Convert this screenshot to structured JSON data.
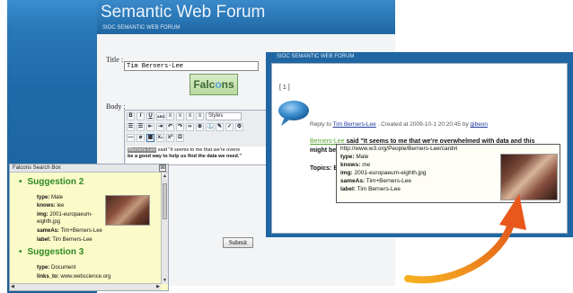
{
  "forum": {
    "title": "Semantic Web Forum",
    "subtitle": "SIOC SEMANTIC WEB FORUM",
    "title_label": "Title :",
    "title_value": "Tim Berners-Lee",
    "body_label": "Body :",
    "logo_text_a": "Falc",
    "logo_text_b": "o",
    "logo_text_c": "ns",
    "styles_value": "Styles",
    "editor_tag": "Berners-Lee",
    "editor_text": " said \"It seems to me that we're overw",
    "editor_text2": "be a good way to help us find the data we need.\"",
    "submit_label": "Submit"
  },
  "toolbar": {
    "row1": [
      "B",
      "I",
      "U",
      "ABC",
      "≡",
      "≡",
      "≡",
      "≡"
    ],
    "row2": [
      "☰",
      "☰",
      "⇤",
      "⇥",
      "↶",
      "↷",
      "∞",
      "⊕",
      "⚓",
      "✎",
      "✓",
      "⚙"
    ],
    "row3": [
      "—",
      "⌀",
      "▦",
      "x₁",
      "x²",
      "Ω"
    ]
  },
  "search_box": {
    "title": "Falcons Search Box",
    "close": "⊠",
    "suggestion2": {
      "heading": "Suggestion 2",
      "type_k": "type:",
      "type_v": " Male",
      "knows_k": "knows:",
      "knows_v": " lee",
      "img_k": "img:",
      "img_v": " 2001-europaeum-",
      "img_v2": "eighth.jpg",
      "sameas_k": "sameAs:",
      "sameas_v": " Tim+Berners-Lee",
      "label_k": "label:",
      "label_v": " Tim Berners-Lee"
    },
    "suggestion3": {
      "heading": "Suggestion 3",
      "type_k": "type:",
      "type_v": " Document",
      "links_k": "links_to:",
      "links_v": " www.webscience.org"
    }
  },
  "post": {
    "subtitle": "SIOC SEMANTIC WEB FORUM",
    "index": "[ 1 ]",
    "reply_prefix": "Reply to ",
    "reply_link": "Tim Berners-Lee",
    "reply_mid": " . Created at 2009-10-1 20:20:45 by ",
    "reply_author": "gibeon",
    "said_name": "Berners-Lee",
    "said_text": " said \"It seems to me that we're overwhelmed with data and this",
    "said_text2": "might be",
    "topics": "Topics: B"
  },
  "tooltip": {
    "url": "http://www.w3.org/People/Berners-Lee/card#i",
    "type_k": "type:",
    "type_v": " Male",
    "knows_k": "knows:",
    "knows_v": " me",
    "img_k": "img:",
    "img_v": " 2001-europaeum-eighth.jpg",
    "sameas_k": "sameAs:",
    "sameas_v": " Tim+Berners-Lee",
    "label_k": "label:",
    "label_v": " Tim Berners-Lee"
  },
  "colors": {
    "header_blue": "#2875b3",
    "suggestion_green": "#2f8a22",
    "arrow_orange": "#f0901e",
    "panel_yellow": "#fbfbc9"
  }
}
